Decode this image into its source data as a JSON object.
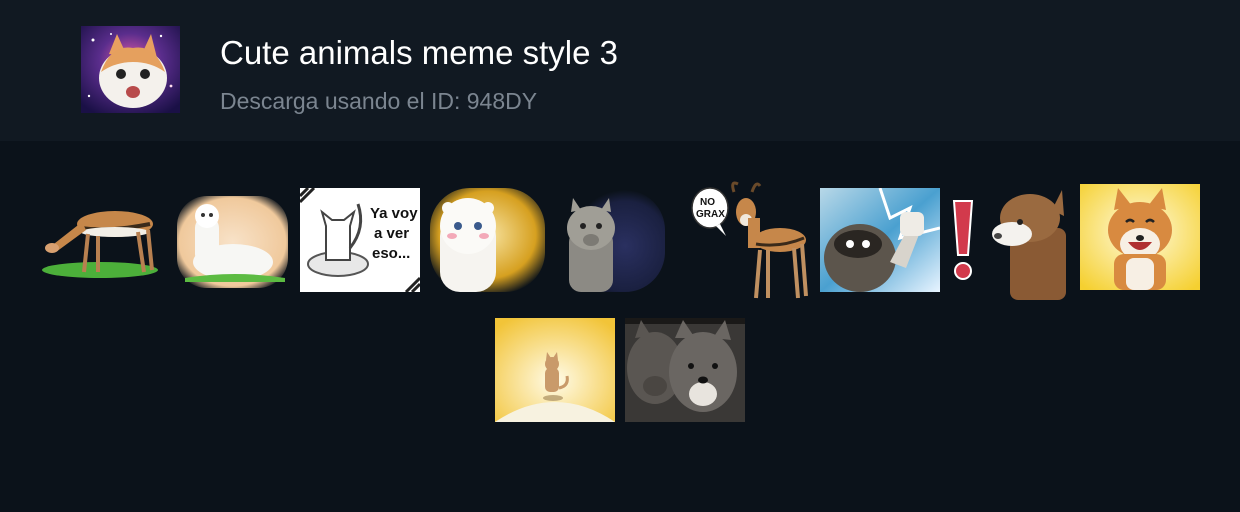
{
  "pack": {
    "title": "Cute animals meme style 3",
    "subtitle": "Descarga usando el ID: 948DY"
  },
  "stickers": [
    {
      "name": "gazelle-grazing"
    },
    {
      "name": "white-alpaca-lying"
    },
    {
      "name": "cat-on-robot-vacuum",
      "text": [
        "Ya voy",
        "a ver",
        "eso..."
      ]
    },
    {
      "name": "alpaca-sparkle"
    },
    {
      "name": "gray-alpaca-dark"
    },
    {
      "name": "gazelle-no-grax",
      "text": [
        "NO",
        "GRAX"
      ]
    },
    {
      "name": "raccoon-fist-lightning"
    },
    {
      "name": "exclamation-mark"
    },
    {
      "name": "brown-alpaca"
    },
    {
      "name": "shiba-laughing"
    },
    {
      "name": "cat-sunburst"
    },
    {
      "name": "two-wolves"
    }
  ],
  "colors": {
    "background": "#0b121a",
    "header_background": "#111922",
    "title": "#ffffff",
    "subtitle": "#7b8590"
  }
}
